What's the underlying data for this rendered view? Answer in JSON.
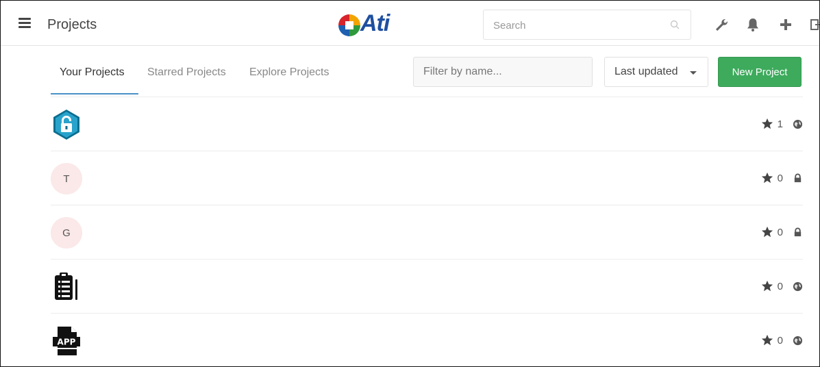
{
  "header": {
    "title": "Projects",
    "logo_text": "Ati",
    "search_placeholder": "Search",
    "icons": [
      "wrench-icon",
      "bell-icon",
      "plus-icon",
      "sign-out-icon"
    ]
  },
  "tabs": [
    {
      "label": "Your Projects",
      "active": true
    },
    {
      "label": "Starred Projects",
      "active": false
    },
    {
      "label": "Explore Projects",
      "active": false
    }
  ],
  "filter": {
    "placeholder": "Filter by name..."
  },
  "sort": {
    "selected": "Last updated"
  },
  "new_project_label": "New Project",
  "projects": [
    {
      "avatar": "lock-hexagon-icon",
      "avatar_letter": "",
      "stars": "1",
      "visibility": "public"
    },
    {
      "avatar": "letter",
      "avatar_letter": "T",
      "stars": "0",
      "visibility": "private"
    },
    {
      "avatar": "letter",
      "avatar_letter": "G",
      "stars": "0",
      "visibility": "private"
    },
    {
      "avatar": "clipboard-list-icon",
      "avatar_letter": "",
      "stars": "0",
      "visibility": "public"
    },
    {
      "avatar": "app-file-icon",
      "avatar_letter": "",
      "stars": "0",
      "visibility": "public"
    }
  ],
  "colors": {
    "accent": "#4a90c8",
    "new_button": "#3daa5c",
    "logo_text": "#1f4fa0",
    "letter_avatar_bg": "#fbe8e8"
  }
}
